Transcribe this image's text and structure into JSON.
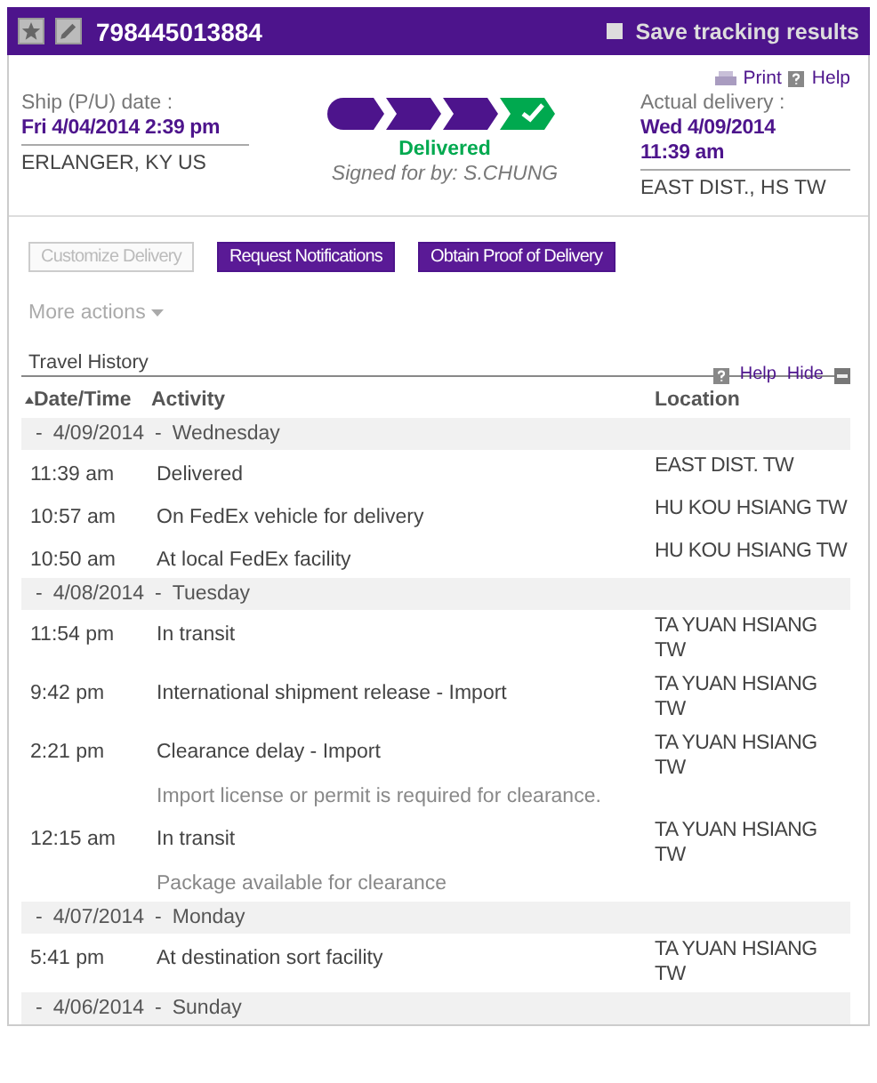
{
  "header": {
    "tracking_number": "798445013884",
    "save_label": "Save tracking results",
    "save_checked": false
  },
  "links": {
    "print": "Print",
    "help": "Help"
  },
  "ship": {
    "label": "Ship (P/U) date :",
    "date": "Fri 4/04/2014 2:39 pm",
    "origin": "ERLANGER, KY  US"
  },
  "progress": {
    "stages": [
      {
        "kind": "transit"
      },
      {
        "kind": "transit"
      },
      {
        "kind": "transit"
      },
      {
        "kind": "delivered"
      }
    ],
    "status": "Delivered",
    "signed": "Signed for by: S.CHUNG"
  },
  "delivery": {
    "label": "Actual delivery :",
    "date": "Wed 4/09/2014",
    "time": "11:39 am",
    "destination": "EAST DIST., HS  TW"
  },
  "actions": [
    {
      "label": "Customize Delivery",
      "disabled": true
    },
    {
      "label": "Request Notifications",
      "disabled": false
    },
    {
      "label": "Obtain Proof of Delivery",
      "disabled": false
    }
  ],
  "more_actions": "More actions",
  "travel_history": {
    "title": "Travel History",
    "help": "Help",
    "hide": "Hide",
    "columns": [
      {
        "label": "Date/Time",
        "sorted": true
      },
      {
        "label": "Activity",
        "sorted": false
      },
      {
        "label": "Location",
        "sorted": false
      }
    ],
    "groups": [
      {
        "toggle": "-",
        "date": "4/09/2014",
        "day": "Wednesday",
        "events": [
          {
            "time": "11:39 am",
            "activity": "Delivered",
            "location": "EAST DIST. TW"
          },
          {
            "time": "10:57 am",
            "activity": "On FedEx vehicle for delivery",
            "location": "HU KOU HSIANG TW"
          },
          {
            "time": "10:50 am",
            "activity": "At local FedEx facility",
            "location": "HU KOU HSIANG TW"
          }
        ]
      },
      {
        "toggle": "-",
        "date": "4/08/2014",
        "day": "Tuesday",
        "events": [
          {
            "time": "11:54 pm",
            "activity": "In transit",
            "location": "TA YUAN HSIANG TW"
          },
          {
            "time": "9:42 pm",
            "activity": "International shipment release - Import",
            "location": "TA YUAN HSIANG TW"
          },
          {
            "time": "2:21 pm",
            "activity": "Clearance delay - Import",
            "location": "TA YUAN HSIANG TW",
            "note": "Import license or permit is required for clearance."
          },
          {
            "time": "12:15 am",
            "activity": "In transit",
            "location": "TA YUAN HSIANG TW",
            "note": "Package available for clearance"
          }
        ]
      },
      {
        "toggle": "-",
        "date": "4/07/2014",
        "day": "Monday",
        "events": [
          {
            "time": "5:41 pm",
            "activity": "At destination sort facility",
            "location": "TA YUAN HSIANG TW"
          }
        ]
      },
      {
        "toggle": "-",
        "date": "4/06/2014",
        "day": "Sunday"
      }
    ]
  }
}
